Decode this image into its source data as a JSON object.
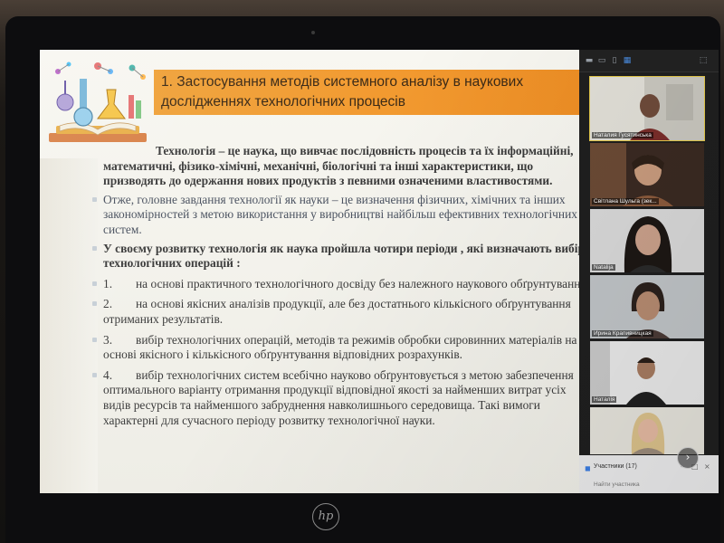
{
  "slide": {
    "title_line1": "1. Застосування методів системного аналізу в наукових",
    "title_line2": "дослідженнях технологічних процесів",
    "p1": "Технологія – це наука, що вивчає послідовність процесів та їх інформаційні, математичні, фізико-хімічні, механічні, біологічні та інші характеристики, що призводять до одержання нових продуктів з певними означеними властивостями.",
    "p2": "Отже, головне завдання технології як науки – це визначення фізичних, хімічних та інших закономірностей з метою використання у виробництві найбільш ефективних технологічних систем.",
    "p3": "У своєму розвитку технологія як наука пройшла чотири періоди , які визначають вибір технологічних операцій :",
    "items": [
      {
        "num": "1.",
        "text": "на основі практичного технологічного досвіду без належного наукового обґрунтування."
      },
      {
        "num": "2.",
        "text": "на основі якісних аналізів продукції, але без достатнього кількісного обґрунтування отриманих результатів."
      },
      {
        "num": "3.",
        "text": "вибір технологічних операцій, методів та режимів обробки сировинних матеріалів  на основі якісного і кількісного обґрунтування відповідних розрахунків."
      },
      {
        "num": "4.",
        "text": "вибір технологічних систем всебічно науково обґрунтовується з метою забезпечення оптимального варіанту  отримання продукції  відповідної якості за найменших витрат усіх видів ресурсів та найменшого забруднення навколишнього середовища. Такі вимоги характерні для сучасного періоду розвитку технологічної науки."
      }
    ]
  },
  "participants": [
    {
      "name": "Наталия Гусятинська"
    },
    {
      "name": "Світлана Шульга (зек..."
    },
    {
      "name": "Natalija"
    },
    {
      "name": "Ирина Крапивницкая"
    },
    {
      "name": "Наталія"
    },
    {
      "name": ""
    }
  ],
  "panel": {
    "participants_label": "Участники (17)",
    "search_label": "Найти участника"
  },
  "icons": {
    "next": "chevron-right-icon",
    "brand": "hp-logo"
  },
  "brand_text": "hp",
  "colors": {
    "title_bar": "#f2992f",
    "slide_bg": "#f2f1ea",
    "active_border": "#e3c84a"
  }
}
